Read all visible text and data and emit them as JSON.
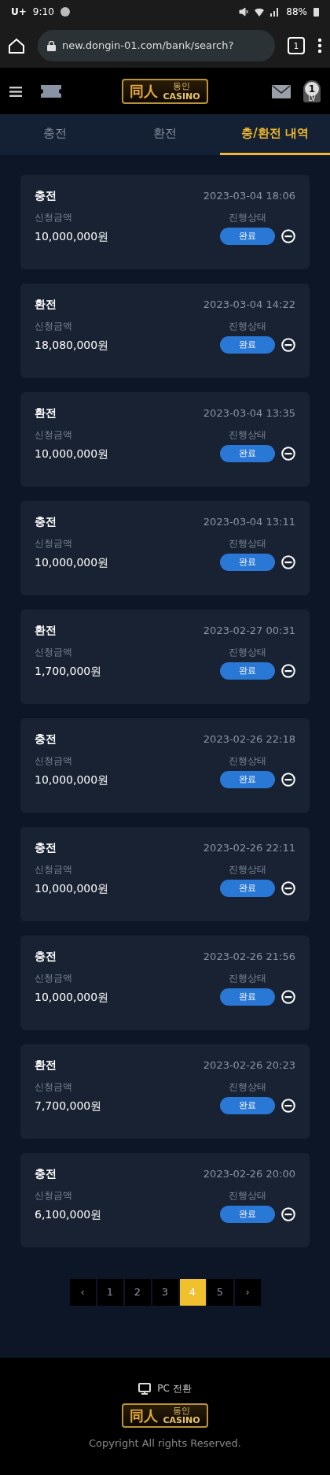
{
  "status_bar": {
    "carrier": "U+",
    "time": "9:10",
    "battery": "88%"
  },
  "browser": {
    "url": "new.dongin-01.com/bank/search?",
    "tab_count": "1"
  },
  "header": {
    "logo": {
      "mark": "同人",
      "name": "동인",
      "sub": "CASINO"
    },
    "level": "1",
    "level_label": "LV"
  },
  "tabs": [
    {
      "label": "충전",
      "selected": false
    },
    {
      "label": "환전",
      "selected": false
    },
    {
      "label": "충/환전 내역",
      "selected": true
    }
  ],
  "records": [
    {
      "type": "충전",
      "datetime": "2023-03-04 18:06",
      "amount_label": "신청금액",
      "amount": "10,000,000원",
      "status_label": "진행상태",
      "status": "완료"
    },
    {
      "type": "환전",
      "datetime": "2023-03-04 14:22",
      "amount_label": "신청금액",
      "amount": "18,080,000원",
      "status_label": "진행상태",
      "status": "완료"
    },
    {
      "type": "환전",
      "datetime": "2023-03-04 13:35",
      "amount_label": "신청금액",
      "amount": "10,000,000원",
      "status_label": "진행상태",
      "status": "완료"
    },
    {
      "type": "충전",
      "datetime": "2023-03-04 13:11",
      "amount_label": "신청금액",
      "amount": "10,000,000원",
      "status_label": "진행상태",
      "status": "완료"
    },
    {
      "type": "환전",
      "datetime": "2023-02-27 00:31",
      "amount_label": "신청금액",
      "amount": "1,700,000원",
      "status_label": "진행상태",
      "status": "완료"
    },
    {
      "type": "충전",
      "datetime": "2023-02-26 22:18",
      "amount_label": "신청금액",
      "amount": "10,000,000원",
      "status_label": "진행상태",
      "status": "완료"
    },
    {
      "type": "충전",
      "datetime": "2023-02-26 22:11",
      "amount_label": "신청금액",
      "amount": "10,000,000원",
      "status_label": "진행상태",
      "status": "완료"
    },
    {
      "type": "충전",
      "datetime": "2023-02-26 21:56",
      "amount_label": "신청금액",
      "amount": "10,000,000원",
      "status_label": "진행상태",
      "status": "완료"
    },
    {
      "type": "환전",
      "datetime": "2023-02-26 20:23",
      "amount_label": "신청금액",
      "amount": "7,700,000원",
      "status_label": "진행상태",
      "status": "완료"
    },
    {
      "type": "충전",
      "datetime": "2023-02-26 20:00",
      "amount_label": "신청금액",
      "amount": "6,100,000원",
      "status_label": "진행상태",
      "status": "완료"
    }
  ],
  "pagination": {
    "prev": "‹",
    "next": "›",
    "pages": [
      {
        "label": "1",
        "selected": false
      },
      {
        "label": "2",
        "selected": false
      },
      {
        "label": "3",
        "selected": false
      },
      {
        "label": "4",
        "selected": true
      },
      {
        "label": "5",
        "selected": false
      }
    ]
  },
  "footer": {
    "pc_switch": "PC 전환",
    "logo": {
      "mark": "同人",
      "name": "동인",
      "sub": "CASINO"
    },
    "copyright": "Copyright All rights Reserved."
  }
}
